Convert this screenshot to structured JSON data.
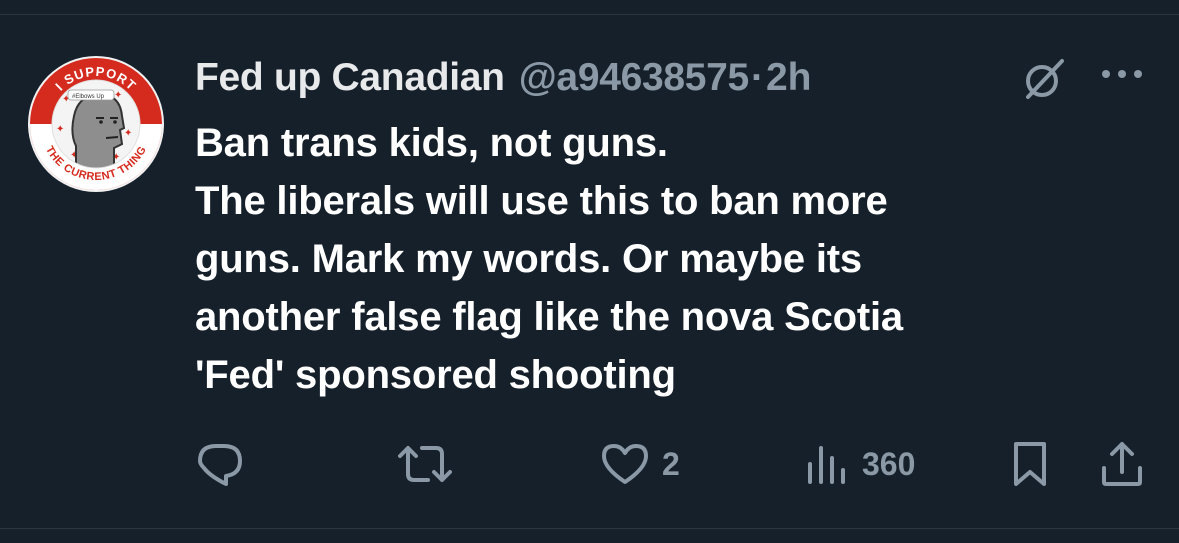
{
  "tweet": {
    "author_name": "Fed up Canadian",
    "handle": "@a94638575",
    "separator": "·",
    "time": "2h",
    "lines": [
      "Ban trans kids, not guns.",
      "The liberals will use this to ban more",
      "guns. Mark my words. Or maybe its",
      "another false flag like the nova Scotia",
      "'Fed' sponsored shooting"
    ]
  },
  "avatar": {
    "top_text": "I SUPPORT",
    "bottom_text": "THE CURRENT THING",
    "badge_text": "#Elbows Up"
  },
  "actions": {
    "reply_count": "",
    "retweet_count": "",
    "like_count": "2",
    "views_count": "360"
  },
  "icons": {
    "reply": "reply-icon",
    "retweet": "retweet-icon",
    "like": "heart-icon",
    "views": "views-icon",
    "bookmark": "bookmark-icon",
    "share": "share-icon",
    "grok": "grok-icon",
    "more": "more-icon"
  },
  "colors": {
    "background": "#15202b",
    "muted": "#8b98a5",
    "text": "#ffffff",
    "badge_red": "#d52b1e"
  }
}
